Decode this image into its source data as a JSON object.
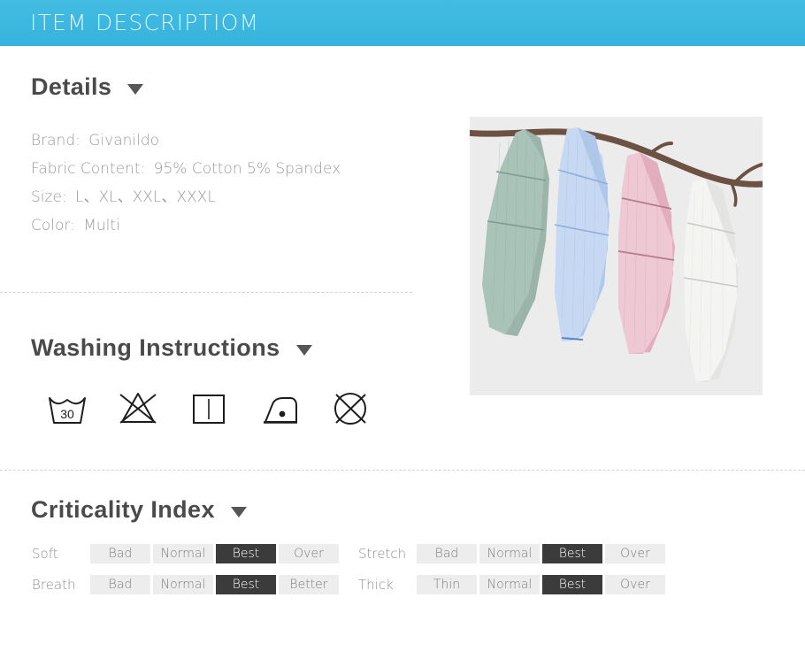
{
  "header": {
    "title": "ITEM DESCRIPTIOM",
    "background_start": "#43bce2",
    "background_end": "#36b3dd",
    "text_color": "#d9f3fb"
  },
  "details": {
    "heading": "Details",
    "caret_icon": "chevron-down-icon",
    "rows": [
      {
        "label": "Brand:",
        "value": "Givanildo"
      },
      {
        "label": "Fabric Content:",
        "value": "95% Cotton  5% Spandex"
      },
      {
        "label": "Size:",
        "value": "L、XL、XXL、XXXL"
      },
      {
        "label": "Color:",
        "value": "Multi"
      }
    ]
  },
  "product_image": {
    "alt": "four textured towels hanging from a tree branch",
    "background": "#ececed",
    "branch_color": "#6d5244",
    "towels": [
      {
        "name": "sage-green-towel",
        "color": "#b7cbc2",
        "shade": "#9cb5aa",
        "stripe": "#7f9a94"
      },
      {
        "name": "light-blue-towel",
        "color": "#c7d9f2",
        "shade": "#a8c2e8",
        "stripe": "#7e9fd2"
      },
      {
        "name": "pink-towel",
        "color": "#eec9d3",
        "shade": "#e2adbd",
        "stripe": "#b27d8d"
      },
      {
        "name": "white-towel",
        "color": "#f2f2f0",
        "shade": "#e2e2e0",
        "stripe": "#c9c9c7"
      }
    ]
  },
  "washing": {
    "heading": "Washing Instructions",
    "caret_icon": "chevron-down-icon",
    "icons": [
      {
        "name": "wash-30-icon",
        "label": "30"
      },
      {
        "name": "do-not-bleach-icon",
        "label": ""
      },
      {
        "name": "drip-dry-icon",
        "label": ""
      },
      {
        "name": "iron-low-icon",
        "label": ""
      },
      {
        "name": "do-not-dry-clean-icon",
        "label": ""
      }
    ]
  },
  "criticality": {
    "heading": "Criticality Index",
    "caret_icon": "chevron-down-icon",
    "active_color": "#3b3b3b",
    "cell_color": "#ededed",
    "rows": [
      {
        "left": {
          "label": "Soft",
          "cells": [
            {
              "label": "Bad",
              "active": false
            },
            {
              "label": "Normal",
              "active": false
            },
            {
              "label": "Best",
              "active": true
            },
            {
              "label": "Over",
              "active": false
            }
          ]
        },
        "right": {
          "label": "Stretch",
          "cells": [
            {
              "label": "Bad",
              "active": false
            },
            {
              "label": "Normal",
              "active": false
            },
            {
              "label": "Best",
              "active": true
            },
            {
              "label": "Over",
              "active": false
            }
          ]
        }
      },
      {
        "left": {
          "label": "Breath",
          "cells": [
            {
              "label": "Bad",
              "active": false
            },
            {
              "label": "Normal",
              "active": false
            },
            {
              "label": "Best",
              "active": true
            },
            {
              "label": "Better",
              "active": false
            }
          ]
        },
        "right": {
          "label": "Thick",
          "cells": [
            {
              "label": "Thin",
              "active": false
            },
            {
              "label": "Normal",
              "active": false
            },
            {
              "label": "Best",
              "active": true
            },
            {
              "label": "Over",
              "active": false
            }
          ]
        }
      }
    ]
  }
}
